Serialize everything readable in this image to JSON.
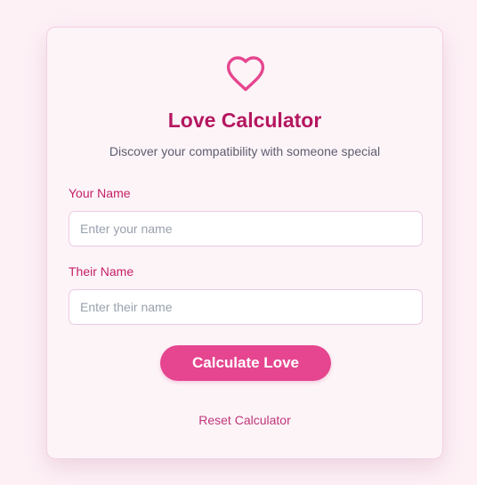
{
  "header": {
    "icon": "heart-icon",
    "title": "Love Calculator",
    "subtitle": "Discover your compatibility with someone special"
  },
  "form": {
    "your_name_label": "Your Name",
    "your_name_placeholder": "Enter your name",
    "your_name_value": "",
    "their_name_label": "Their Name",
    "their_name_placeholder": "Enter their name",
    "their_name_value": ""
  },
  "actions": {
    "calculate_label": "Calculate Love",
    "reset_label": "Reset Calculator"
  },
  "colors": {
    "accent": "#e5468f",
    "title": "#b5175f",
    "label": "#c42068",
    "link": "#c0367a",
    "background": "#fdf1f6"
  }
}
